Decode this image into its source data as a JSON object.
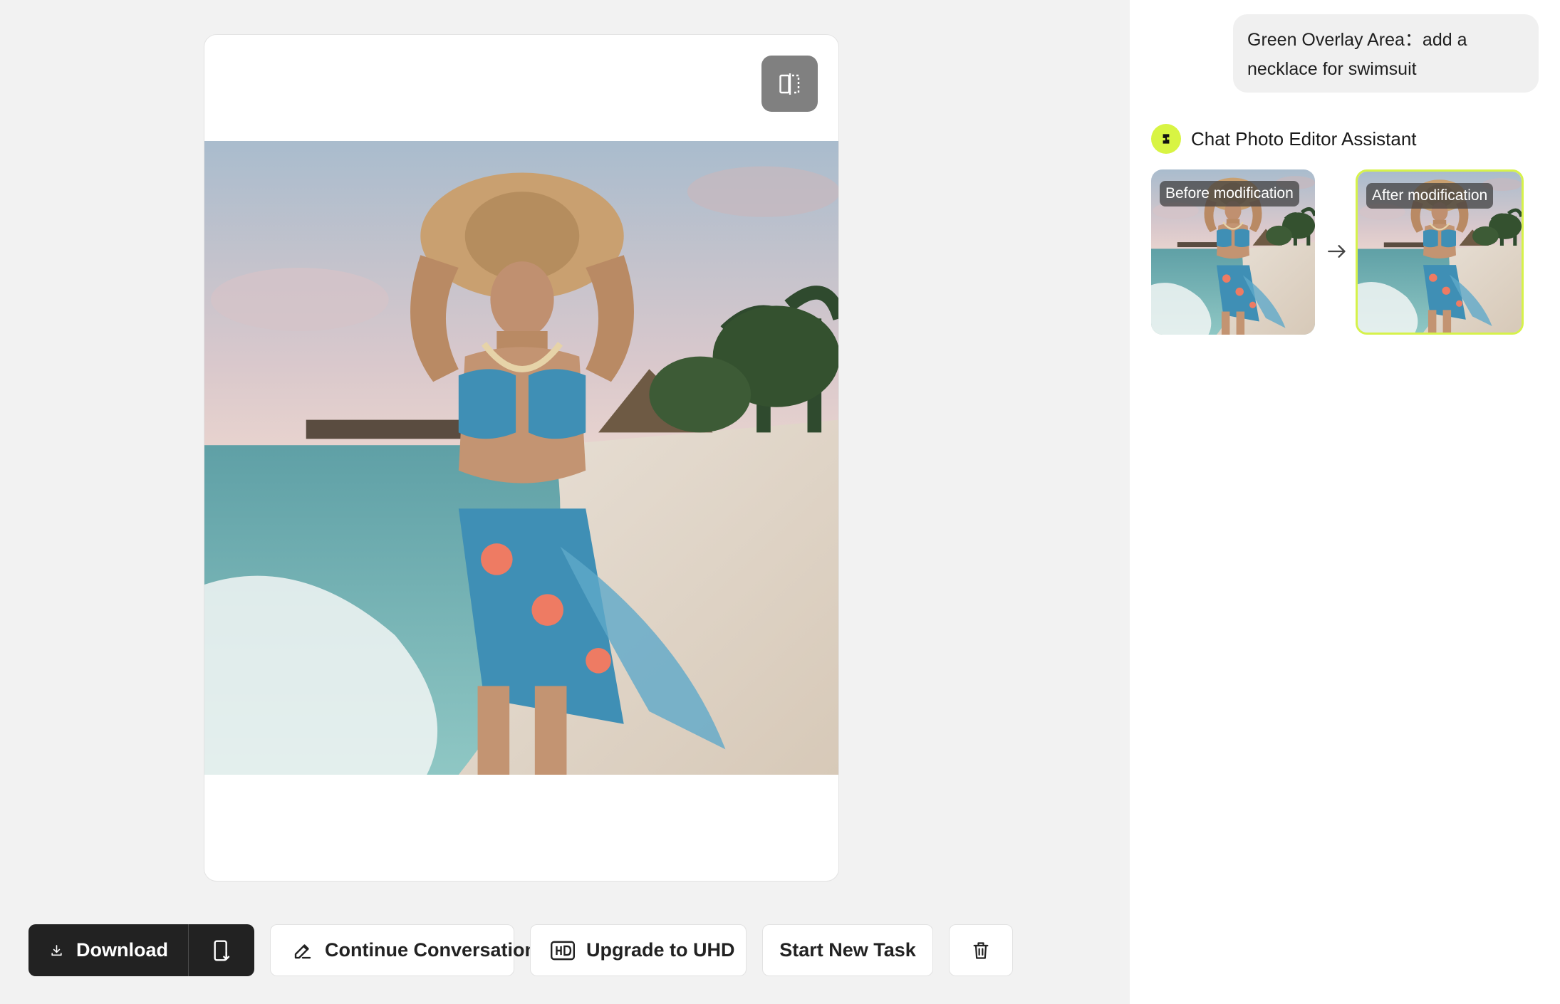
{
  "preview": {
    "compare_icon": "split-compare-icon",
    "image_alt": "Edited beach photo"
  },
  "actions": {
    "download_label": "Download",
    "continue_label": "Continue Conversation",
    "upgrade_label": "Upgrade to UHD",
    "new_task_label": "Start New Task",
    "icons": {
      "download": "download-icon",
      "device": "save-to-device-icon",
      "continue": "edit-pen-icon",
      "upgrade": "hd-icon",
      "delete": "trash-icon"
    }
  },
  "chat": {
    "user_message": "Green Overlay Area：add a necklace for swimsuit",
    "assistant_name": "Chat Photo Editor Assistant",
    "before_label": "Before modification",
    "after_label": "After modification"
  },
  "colors": {
    "accent": "#d8f443",
    "dark_button": "#222222",
    "sidebar_bg": "#ffffff",
    "main_bg": "#f2f2f2"
  }
}
